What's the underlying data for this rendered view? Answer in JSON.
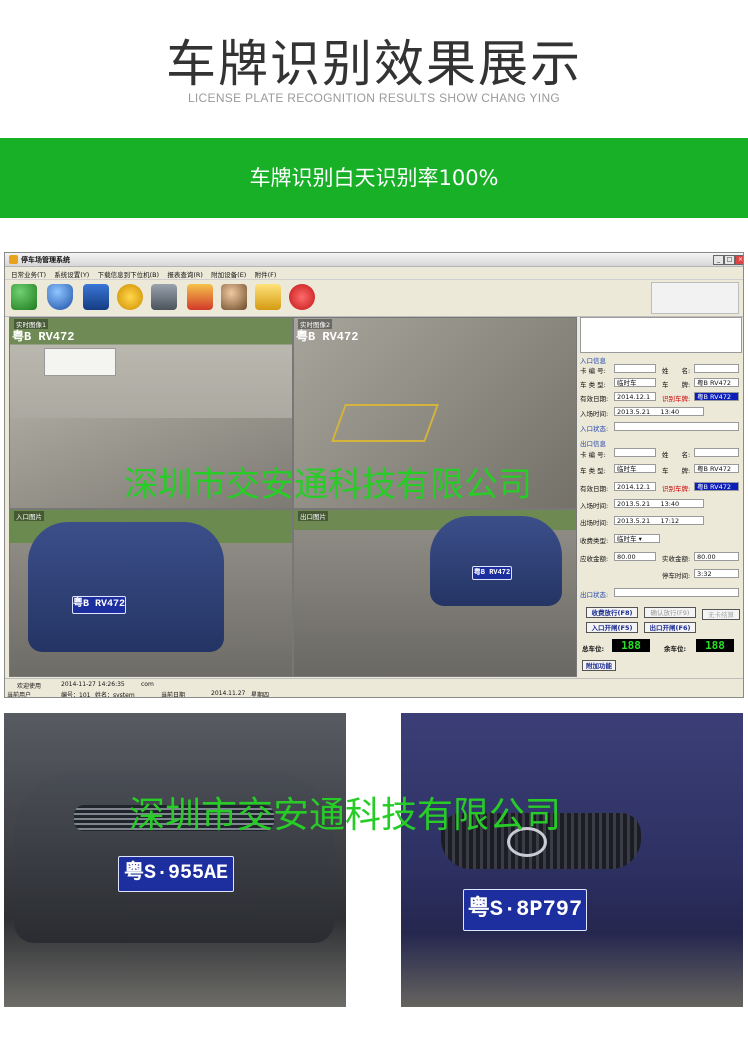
{
  "header": {
    "title": "车牌识别效果展示",
    "subtitle": "LICENSE PLATE RECOGNITION RESULTS SHOW CHANG YING"
  },
  "band": {
    "text": "车牌识别白天识别率100%"
  },
  "window": {
    "title": "停车场管理系统",
    "menu": [
      "日常业务(T)",
      "系统设置(Y)",
      "下载信息到下位机(B)",
      "报表查询(R)",
      "附加设备(E)",
      "附件(F)"
    ],
    "cameras": {
      "cam1": {
        "label": "实时图像1",
        "plate_overlay": "粤B RV472"
      },
      "cam2": {
        "label": "实时图像2",
        "plate_overlay": "粤B RV472"
      },
      "in_photo": {
        "label": "入口图片",
        "plate": "粤B RV472"
      },
      "out_photo": {
        "label": "出口图片",
        "plate": "粤B RV472"
      }
    },
    "entry": {
      "section": "入口信息",
      "card_no_label": "卡 编 号:",
      "name_label": "姓　　名:",
      "type_label": "车 类 型:",
      "type_value": "临时车",
      "plate_label": "车　　牌:",
      "plate_value": "粤B RV472",
      "valid_label": "有效日期:",
      "valid_value": "2014.12.1",
      "recog_label": "识别车牌:",
      "recog_value": "粤B RV472",
      "time_label": "入场时间:",
      "time_date": "2013.5.21",
      "time_clock": "13:40",
      "status_label": "入口状态:"
    },
    "exit": {
      "section": "出口信息",
      "card_no_label": "卡 编 号:",
      "name_label": "姓　　名:",
      "type_label": "车 类 型:",
      "type_value": "临时车",
      "plate_label": "车　　牌:",
      "plate_value": "粤B RV472",
      "valid_label": "有效日期:",
      "valid_value": "2014.12.1",
      "recog_label": "识别车牌:",
      "recog_value": "粤B RV472",
      "in_time_label": "入场时间:",
      "in_date": "2013.5.21",
      "in_clock": "13:40",
      "out_time_label": "出场时间:",
      "out_date": "2013.5.21",
      "out_clock": "17:12",
      "fee_type_label": "收费类型:",
      "fee_type_value": "临时车",
      "due_label": "应收金额:",
      "due_value": "80.00",
      "paid_label": "实收金额:",
      "paid_value": "80.00",
      "stay_label": "停车时间:",
      "stay_value": "3:32",
      "status_label": "出口状态:"
    },
    "buttons": {
      "charge_release": "收费放行(F8)",
      "confirm_release": "确认放行(F9)",
      "no_card": "无卡结算",
      "entry_open": "入口开闸(F5)",
      "exit_open": "出口开闸(F6)",
      "extra": "附加功能"
    },
    "counters": {
      "total_label": "总车位:",
      "total_value": "188",
      "remain_label": "余车位:",
      "remain_value": "188"
    },
    "status": {
      "welcome": "欢迎使用",
      "datetime": "2014-11-27 14:26:35",
      "com": "com",
      "user_label": "当前用户",
      "user_id": "编号：101",
      "user_name": "姓名：system",
      "date_label": "当前日期",
      "date_value": "2014.11.27",
      "weekday": "星期四"
    }
  },
  "photos": {
    "left_plate": "粤S·955AE",
    "right_plate": "粤S·8P797"
  },
  "watermark": "深圳市交安通科技有限公司",
  "colors": {
    "band_green": "#17b027",
    "watermark_green": "#27cc27",
    "plate_blue": "#1d2f9e"
  }
}
